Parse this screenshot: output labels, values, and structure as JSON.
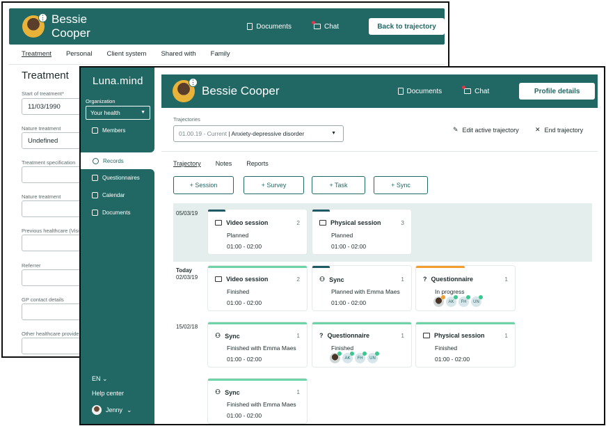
{
  "back_window": {
    "header": {
      "name": "Bessie Cooper",
      "documents": "Documents",
      "chat": "Chat",
      "button": "Back to trajectory"
    },
    "tabs": [
      "Treatment",
      "Personal",
      "Client system",
      "Shared with",
      "Family"
    ],
    "section_title": "Treatment",
    "fields": [
      {
        "label": "Start of treatment*",
        "value": "11/03/1990"
      },
      {
        "label": "Nature treatment",
        "value": "Undefined"
      },
      {
        "label": "Treatment specification",
        "value": ""
      },
      {
        "label": "Nature treatment",
        "value": ""
      },
      {
        "label": "Previous healthcare (Visib",
        "value": ""
      },
      {
        "label": "Referrer",
        "value": ""
      },
      {
        "label": "GP contact details",
        "value": ""
      },
      {
        "label": "Other healthcare provider",
        "value": ""
      }
    ]
  },
  "sidebar": {
    "logo": "Luna.mind",
    "org_label": "Organization",
    "org_value": "Your health",
    "items": [
      {
        "label": "Members",
        "icon": "members-icon"
      },
      {
        "label": "Records",
        "icon": "records-icon"
      },
      {
        "label": "Questionnaires",
        "icon": "questionnaires-icon"
      },
      {
        "label": "Calendar",
        "icon": "calendar-icon"
      },
      {
        "label": "Documents",
        "icon": "documents-icon"
      }
    ],
    "language": "EN",
    "help": "Help center",
    "user": "Jenny"
  },
  "front_header": {
    "name": "Bessie Cooper",
    "documents": "Documents",
    "chat": "Chat",
    "button": "Profile details"
  },
  "trajectory": {
    "label": "Trajectories",
    "range": "01.00.19 - Current",
    "name": "Anxiety-depressive disorder",
    "edit": "Edit active trajectory",
    "end": "End trajectory"
  },
  "tabs": [
    "Trajectory",
    "Notes",
    "Reports"
  ],
  "add_buttons": [
    "+ Session",
    "+ Survey",
    "+ Task",
    "+ Sync"
  ],
  "dates": [
    {
      "top": "",
      "date": "05/03/19"
    },
    {
      "top": "Today",
      "date": "02/03/19"
    },
    {
      "top": "",
      "date": "15/02/18"
    }
  ],
  "cards": [
    {
      "title": "Video session",
      "count": "2",
      "status": "Planned",
      "time": "01:00 - 02:00"
    },
    {
      "title": "Physical session",
      "count": "3",
      "status": "Planned",
      "time": "01:00 - 02:00"
    },
    {
      "title": "Video session",
      "count": "2",
      "status": "Finished",
      "time": "01:00 - 02:00"
    },
    {
      "title": "Sync",
      "count": "1",
      "status": "Planned with Emma Maes",
      "time": "01:00 - 02:00"
    },
    {
      "title": "Questionnaire",
      "count": "1",
      "status": "In progress",
      "chips": [
        "AK",
        "FH",
        "UN"
      ]
    },
    {
      "title": "Sync",
      "count": "1",
      "status": "Finished with Emma Maes",
      "time": "01:00 - 02:00"
    },
    {
      "title": "Questionnaire",
      "count": "1",
      "status": "Finished",
      "chips": [
        "AK",
        "FH",
        "UN"
      ]
    },
    {
      "title": "Physical session",
      "count": "1",
      "status": "Finished",
      "time": "01:00 - 02:00"
    },
    {
      "title": "Sync",
      "count": "1",
      "status": "Finished with Emma Maes",
      "time": "01:00 - 02:00"
    }
  ],
  "colors": {
    "brand": "#216864",
    "green": "#6ed3a6",
    "orange": "#f29e2e",
    "dark": "#1e5a63",
    "band": "#e4eeec"
  }
}
